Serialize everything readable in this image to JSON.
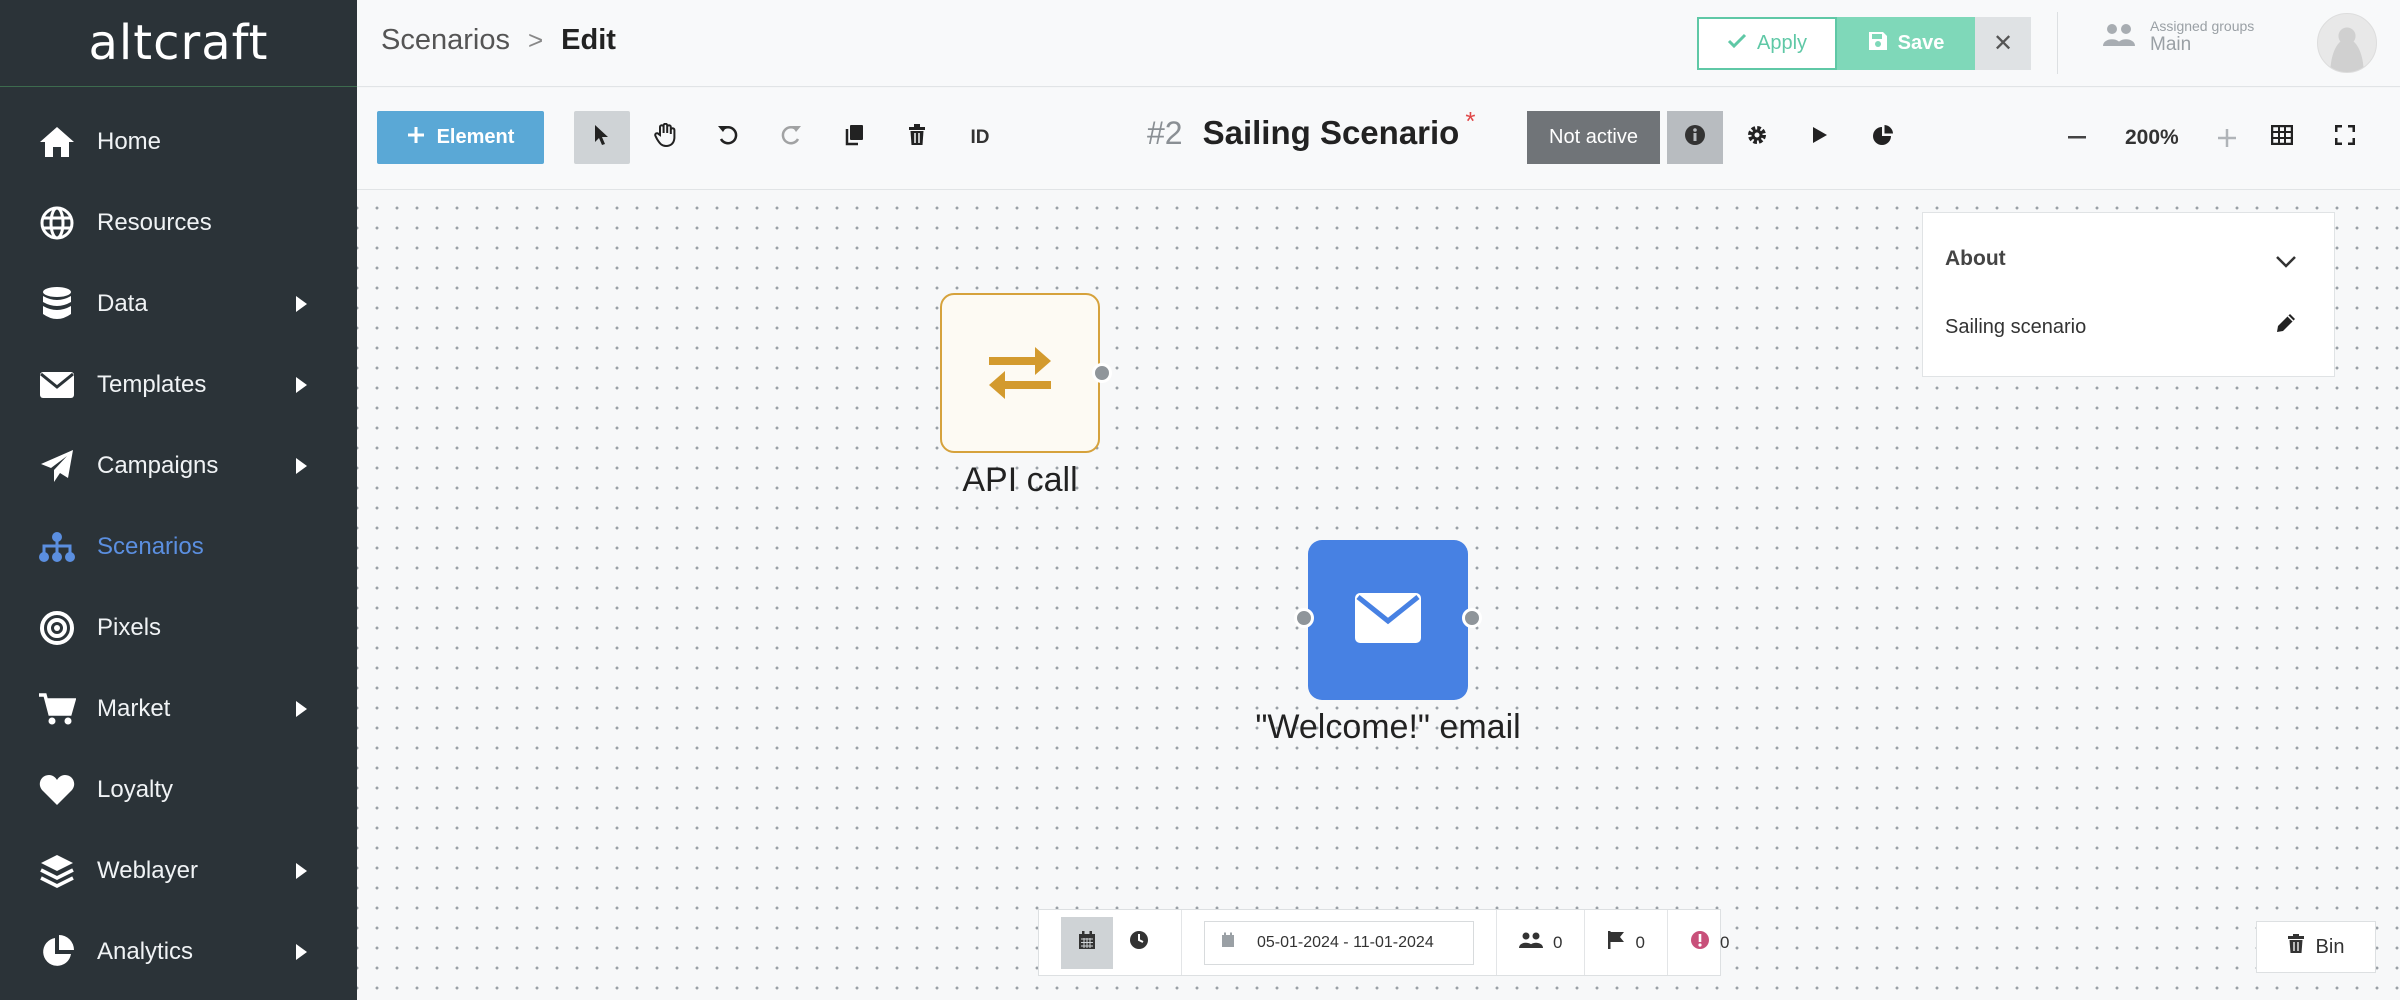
{
  "brand": {
    "logo_text": "altcraft"
  },
  "sidebar": {
    "items": [
      {
        "label": "Home",
        "icon": "home-icon",
        "has_arrow": false
      },
      {
        "label": "Resources",
        "icon": "globe-icon",
        "has_arrow": false
      },
      {
        "label": "Data",
        "icon": "database-icon",
        "has_arrow": true
      },
      {
        "label": "Templates",
        "icon": "envelope-icon",
        "has_arrow": true
      },
      {
        "label": "Campaigns",
        "icon": "paper-plane-icon",
        "has_arrow": true
      },
      {
        "label": "Scenarios",
        "icon": "sitemap-icon",
        "has_arrow": false,
        "active": true
      },
      {
        "label": "Pixels",
        "icon": "target-icon",
        "has_arrow": false
      },
      {
        "label": "Market",
        "icon": "cart-icon",
        "has_arrow": true
      },
      {
        "label": "Loyalty",
        "icon": "heart-icon",
        "has_arrow": false
      },
      {
        "label": "Weblayer",
        "icon": "layers-icon",
        "has_arrow": true
      },
      {
        "label": "Analytics",
        "icon": "pie-chart-icon",
        "has_arrow": true
      }
    ],
    "active_color": "#5b8fe0"
  },
  "header": {
    "breadcrumb": {
      "parent": "Scenarios",
      "separator": ">",
      "current": "Edit"
    },
    "apply_label": "Apply",
    "save_label": "Save",
    "close_label": "✕",
    "groups": {
      "caption": "Assigned groups",
      "value": "Main"
    }
  },
  "toolbar": {
    "element_label": "Element",
    "id_label": "ID",
    "scenario_number": "#2",
    "scenario_name": "Sailing Scenario",
    "unsaved_marker": "*",
    "status_label": "Not active",
    "zoom_value": "200%"
  },
  "canvas": {
    "nodes": [
      {
        "label": "API call",
        "icon": "exchange-arrows-icon",
        "color": "#d6a23c"
      },
      {
        "label": "\"Welcome!\" email",
        "icon": "envelope-icon",
        "color": "#4781e3"
      }
    ]
  },
  "about_panel": {
    "title": "About",
    "description": "Sailing scenario"
  },
  "bottom_bar": {
    "date_range": "05-01-2024 - 11-01-2024",
    "users_count": "0",
    "flags_count": "0",
    "errors_count": "0"
  },
  "bin_label": "Bin"
}
